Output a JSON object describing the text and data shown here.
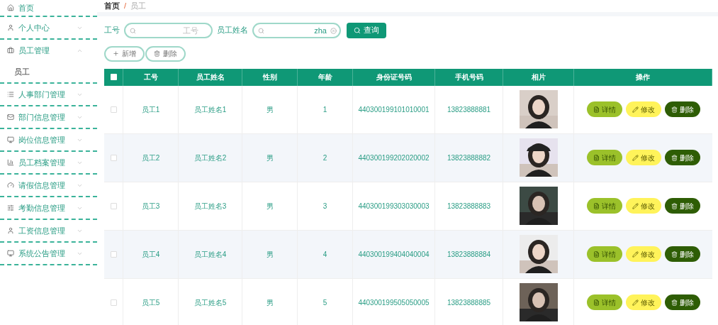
{
  "sidebar": {
    "items": [
      {
        "label": "首页"
      },
      {
        "label": "个人中心",
        "expanded": false
      },
      {
        "label": "员工管理",
        "expanded": true,
        "children": [
          {
            "label": "员工"
          }
        ]
      },
      {
        "label": "人事部门管理",
        "expanded": false
      },
      {
        "label": "部门信息管理",
        "expanded": false
      },
      {
        "label": "岗位信息管理",
        "expanded": false
      },
      {
        "label": "员工档案管理",
        "expanded": false
      },
      {
        "label": "请假信息管理",
        "expanded": false
      },
      {
        "label": "考勤信息管理",
        "expanded": false
      },
      {
        "label": "工资信息管理",
        "expanded": false
      },
      {
        "label": "系统公告管理",
        "expanded": false
      }
    ]
  },
  "breadcrumb": {
    "items": [
      "首页",
      "员工"
    ],
    "separator": "/"
  },
  "search": {
    "fields": [
      {
        "label": "工号",
        "placeholder": "工号"
      },
      {
        "label": "员工姓名",
        "value": "zha"
      }
    ],
    "button": "查询"
  },
  "actions": [
    "新增",
    "删除"
  ],
  "table": {
    "select_all": false,
    "columns": [
      "工号",
      "员工姓名",
      "性别",
      "年龄",
      "身份证号码",
      "手机号码",
      "相片",
      "操作"
    ],
    "rows": [
      {
        "checked": false,
        "cells": [
          "员工1",
          "员工姓名1",
          "男",
          "1",
          "440300199101010001",
          "13823888881"
        ],
        "buttons": [
          "详情",
          "修改",
          "删除"
        ]
      },
      {
        "checked": false,
        "cells": [
          "员工2",
          "员工姓名2",
          "男",
          "2",
          "440300199202020002",
          "13823888882"
        ],
        "buttons": [
          "详情",
          "修改",
          "删除"
        ]
      },
      {
        "checked": false,
        "cells": [
          "员工3",
          "员工姓名3",
          "男",
          "3",
          "440300199303030003",
          "13823888883"
        ],
        "buttons": [
          "详情",
          "修改",
          "删除"
        ]
      },
      {
        "checked": false,
        "cells": [
          "员工4",
          "员工姓名4",
          "男",
          "4",
          "440300199404040004",
          "13823888884"
        ],
        "buttons": [
          "详情",
          "修改",
          "删除"
        ]
      },
      {
        "checked": false,
        "cells": [
          "员工5",
          "员工姓名5",
          "男",
          "5",
          "440300199505050005",
          "13823888885"
        ],
        "buttons": [
          "详情",
          "修改",
          "删除"
        ]
      }
    ]
  }
}
